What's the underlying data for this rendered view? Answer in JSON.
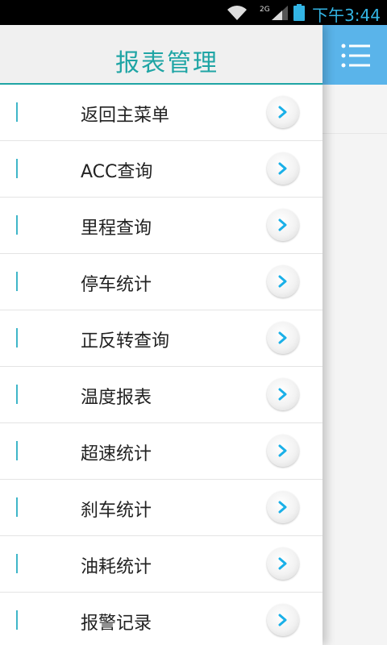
{
  "status_bar": {
    "network_type": "2G",
    "time": "下午3:44",
    "icons": [
      "wifi-icon",
      "signal-icon",
      "battery-icon"
    ]
  },
  "drawer": {
    "title": "报表管理",
    "items": [
      {
        "label": "返回主菜单"
      },
      {
        "label": "ACC查询"
      },
      {
        "label": "里程查询"
      },
      {
        "label": "停车统计"
      },
      {
        "label": "正反转查询"
      },
      {
        "label": "温度报表"
      },
      {
        "label": "超速统计"
      },
      {
        "label": "刹车统计"
      },
      {
        "label": "油耗统计"
      },
      {
        "label": "报警记录"
      }
    ]
  },
  "main": {
    "menu_icon": "list-menu-icon"
  },
  "colors": {
    "title": "#1fa5a5",
    "accent_bar": "#3fb6c9",
    "header_blue": "#5ab4ea",
    "arrow": "#1ab0e8",
    "status_text": "#33b5e5"
  }
}
